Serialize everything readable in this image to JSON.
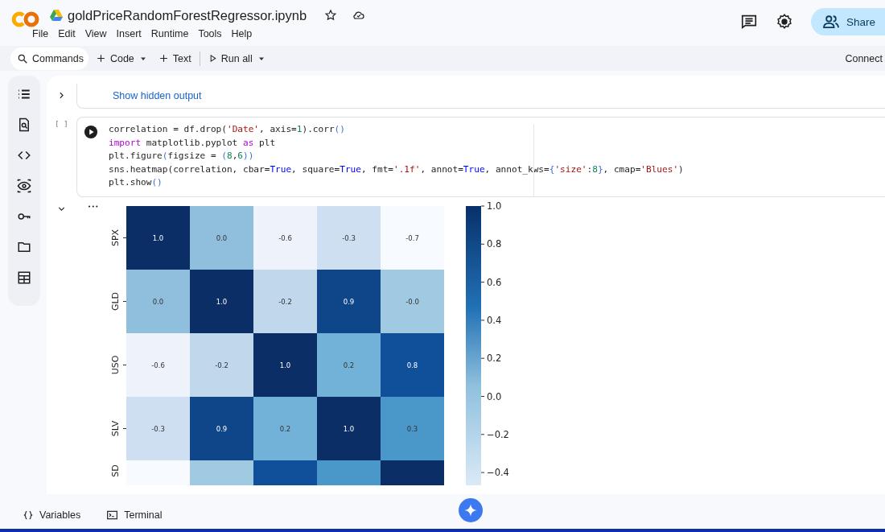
{
  "header": {
    "title": "goldPriceRandomForestRegressor.ipynb",
    "menu": [
      "File",
      "Edit",
      "View",
      "Insert",
      "Runtime",
      "Tools",
      "Help"
    ],
    "share": "Share"
  },
  "toolbar": {
    "commands": "Commands",
    "code": "Code",
    "text": "Text",
    "run_all": "Run all",
    "connect": "Connect"
  },
  "cells": [
    {
      "kind": "output",
      "expanded": false,
      "text": "Show hidden output"
    },
    {
      "kind": "code",
      "prompt": "[ ]",
      "lines": [
        [
          {
            "kind": "plain",
            "text": "correlation = df.drop("
          },
          {
            "kind": "string",
            "text": "'Date'"
          },
          {
            "kind": "plain",
            "text": ", axis="
          },
          {
            "kind": "number",
            "text": "1"
          },
          {
            "kind": "plain",
            "text": ").corr"
          },
          {
            "kind": "paren",
            "text": "()"
          }
        ],
        [
          {
            "kind": "keyword",
            "text": "import"
          },
          {
            "kind": "plain",
            "text": " matplotlib.pyplot "
          },
          {
            "kind": "keyword",
            "text": "as"
          },
          {
            "kind": "plain",
            "text": " plt"
          }
        ],
        [
          {
            "kind": "plain",
            "text": "plt.figure"
          },
          {
            "kind": "paren",
            "text": "("
          },
          {
            "kind": "plain",
            "text": "figsize = "
          },
          {
            "kind": "paren",
            "text": "("
          },
          {
            "kind": "number",
            "text": "8"
          },
          {
            "kind": "plain",
            "text": ","
          },
          {
            "kind": "number",
            "text": "6"
          },
          {
            "kind": "paren",
            "text": "))"
          }
        ],
        [
          {
            "kind": "plain",
            "text": "sns.heatmap(correlation, cbar="
          },
          {
            "kind": "const",
            "text": "True"
          },
          {
            "kind": "plain",
            "text": ", square="
          },
          {
            "kind": "const",
            "text": "True"
          },
          {
            "kind": "plain",
            "text": ", fmt="
          },
          {
            "kind": "string",
            "text": "'.1f'"
          },
          {
            "kind": "plain",
            "text": ", annot="
          },
          {
            "kind": "const",
            "text": "True"
          },
          {
            "kind": "plain",
            "text": ", annot_kws="
          },
          {
            "kind": "paren",
            "text": "{"
          },
          {
            "kind": "string",
            "text": "'size'"
          },
          {
            "kind": "plain",
            "text": ":"
          },
          {
            "kind": "number",
            "text": "8"
          },
          {
            "kind": "paren",
            "text": "}"
          },
          {
            "kind": "plain",
            "text": ", cmap="
          },
          {
            "kind": "string",
            "text": "'Blues'"
          },
          {
            "kind": "plain",
            "text": ")"
          }
        ],
        [
          {
            "kind": "plain",
            "text": "plt.show"
          },
          {
            "kind": "paren",
            "text": "()"
          }
        ]
      ]
    }
  ],
  "output": {
    "expanded": true,
    "more": "•••",
    "heatmap": {
      "rows": [
        {
          "label": "SPX",
          "cells": [
            {
              "text": "1.0",
              "color": "#0b2e66"
            },
            {
              "text": "0.0",
              "color": "#8fbfdd"
            },
            {
              "text": "-0.6",
              "color": "#eef3fb"
            },
            {
              "text": "-0.3",
              "color": "#cfdff2"
            },
            {
              "text": "-0.7",
              "color": "#f7fbff"
            }
          ]
        },
        {
          "label": "GLD",
          "cells": [
            {
              "text": "0.0",
              "color": "#8fbfdd"
            },
            {
              "text": "1.0",
              "color": "#0b2e66"
            },
            {
              "text": "-0.2",
              "color": "#c0d7ec"
            },
            {
              "text": "0.9",
              "color": "#0f4689"
            },
            {
              "text": "-0.0",
              "color": "#a0c9e2"
            }
          ]
        },
        {
          "label": "USO",
          "cells": [
            {
              "text": "-0.6",
              "color": "#eef3fb"
            },
            {
              "text": "-0.2",
              "color": "#c0d7ec"
            },
            {
              "text": "1.0",
              "color": "#0b2e66"
            },
            {
              "text": "0.2",
              "color": "#73b2d8"
            },
            {
              "text": "0.8",
              "color": "#10509a"
            }
          ]
        },
        {
          "label": "SLV",
          "cells": [
            {
              "text": "-0.3",
              "color": "#cfdff2"
            },
            {
              "text": "0.9",
              "color": "#0f4689"
            },
            {
              "text": "0.2",
              "color": "#73b2d8"
            },
            {
              "text": "1.0",
              "color": "#0b2e66"
            },
            {
              "text": "0.3",
              "color": "#4a98c9"
            }
          ]
        },
        {
          "label": "SD",
          "cells": [
            {
              "color": "#f7fbff"
            },
            {
              "color": "#a0c9e2"
            },
            {
              "color": "#10509a"
            },
            {
              "color": "#4a98c9"
            },
            {
              "color": "#0b2e66"
            }
          ]
        }
      ],
      "colorbar_ticks": [
        "1.0",
        "0.8",
        "0.6",
        "0.4",
        "0.2",
        "0.0",
        "−0.2",
        "−0.4"
      ]
    }
  },
  "footer": {
    "variables": "Variables",
    "terminal": "Terminal"
  }
}
